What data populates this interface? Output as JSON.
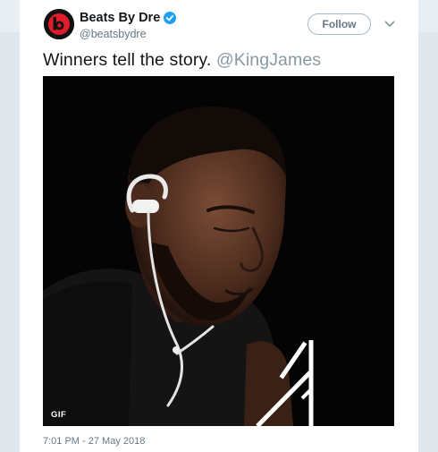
{
  "tweet": {
    "display_name": "Beats By Dre",
    "handle": "@beatsbydre",
    "verified": true,
    "follow_label": "Follow",
    "text": "Winners tell the story.",
    "mention": "@KingJames",
    "media_badge": "GIF",
    "timestamp": "7:01 PM - 27 May 2018"
  },
  "colors": {
    "brand_red": "#e21b2a",
    "verified_blue": "#1da1f2",
    "mention_gray": "#8899a6"
  },
  "icons": {
    "avatar": "beats-logo-icon",
    "verified": "verified-badge-icon",
    "menu": "chevron-down-icon"
  }
}
